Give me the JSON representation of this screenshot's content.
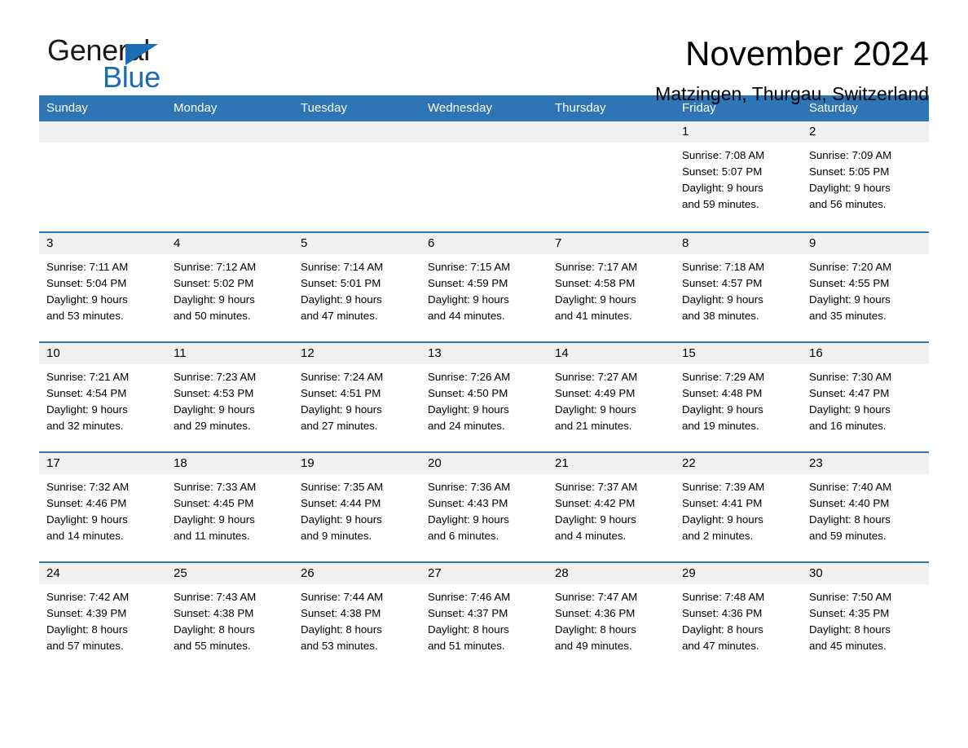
{
  "brand": {
    "name_part1": "General",
    "name_part2": "Blue",
    "triangle_icon": "blue-triangle-icon",
    "accent_color": "#1b6cb3"
  },
  "header": {
    "title": "November 2024",
    "subtitle": "Matzingen, Thurgau, Switzerland"
  },
  "theme": {
    "header_blue": "#2e75b6",
    "daynum_gray": "#f1f1f1",
    "text_black": "#000000"
  },
  "weekday_headers": [
    "Sunday",
    "Monday",
    "Tuesday",
    "Wednesday",
    "Thursday",
    "Friday",
    "Saturday"
  ],
  "weeks": [
    [
      {
        "day": "",
        "blank": true,
        "sunrise": "",
        "sunset": "",
        "daylight_line1": "",
        "daylight_line2": ""
      },
      {
        "day": "",
        "blank": true,
        "sunrise": "",
        "sunset": "",
        "daylight_line1": "",
        "daylight_line2": ""
      },
      {
        "day": "",
        "blank": true,
        "sunrise": "",
        "sunset": "",
        "daylight_line1": "",
        "daylight_line2": ""
      },
      {
        "day": "",
        "blank": true,
        "sunrise": "",
        "sunset": "",
        "daylight_line1": "",
        "daylight_line2": ""
      },
      {
        "day": "",
        "blank": true,
        "sunrise": "",
        "sunset": "",
        "daylight_line1": "",
        "daylight_line2": ""
      },
      {
        "day": "1",
        "blank": false,
        "sunrise": "Sunrise: 7:08 AM",
        "sunset": "Sunset: 5:07 PM",
        "daylight_line1": "Daylight: 9 hours",
        "daylight_line2": "and 59 minutes."
      },
      {
        "day": "2",
        "blank": false,
        "sunrise": "Sunrise: 7:09 AM",
        "sunset": "Sunset: 5:05 PM",
        "daylight_line1": "Daylight: 9 hours",
        "daylight_line2": "and 56 minutes."
      }
    ],
    [
      {
        "day": "3",
        "blank": false,
        "sunrise": "Sunrise: 7:11 AM",
        "sunset": "Sunset: 5:04 PM",
        "daylight_line1": "Daylight: 9 hours",
        "daylight_line2": "and 53 minutes."
      },
      {
        "day": "4",
        "blank": false,
        "sunrise": "Sunrise: 7:12 AM",
        "sunset": "Sunset: 5:02 PM",
        "daylight_line1": "Daylight: 9 hours",
        "daylight_line2": "and 50 minutes."
      },
      {
        "day": "5",
        "blank": false,
        "sunrise": "Sunrise: 7:14 AM",
        "sunset": "Sunset: 5:01 PM",
        "daylight_line1": "Daylight: 9 hours",
        "daylight_line2": "and 47 minutes."
      },
      {
        "day": "6",
        "blank": false,
        "sunrise": "Sunrise: 7:15 AM",
        "sunset": "Sunset: 4:59 PM",
        "daylight_line1": "Daylight: 9 hours",
        "daylight_line2": "and 44 minutes."
      },
      {
        "day": "7",
        "blank": false,
        "sunrise": "Sunrise: 7:17 AM",
        "sunset": "Sunset: 4:58 PM",
        "daylight_line1": "Daylight: 9 hours",
        "daylight_line2": "and 41 minutes."
      },
      {
        "day": "8",
        "blank": false,
        "sunrise": "Sunrise: 7:18 AM",
        "sunset": "Sunset: 4:57 PM",
        "daylight_line1": "Daylight: 9 hours",
        "daylight_line2": "and 38 minutes."
      },
      {
        "day": "9",
        "blank": false,
        "sunrise": "Sunrise: 7:20 AM",
        "sunset": "Sunset: 4:55 PM",
        "daylight_line1": "Daylight: 9 hours",
        "daylight_line2": "and 35 minutes."
      }
    ],
    [
      {
        "day": "10",
        "blank": false,
        "sunrise": "Sunrise: 7:21 AM",
        "sunset": "Sunset: 4:54 PM",
        "daylight_line1": "Daylight: 9 hours",
        "daylight_line2": "and 32 minutes."
      },
      {
        "day": "11",
        "blank": false,
        "sunrise": "Sunrise: 7:23 AM",
        "sunset": "Sunset: 4:53 PM",
        "daylight_line1": "Daylight: 9 hours",
        "daylight_line2": "and 29 minutes."
      },
      {
        "day": "12",
        "blank": false,
        "sunrise": "Sunrise: 7:24 AM",
        "sunset": "Sunset: 4:51 PM",
        "daylight_line1": "Daylight: 9 hours",
        "daylight_line2": "and 27 minutes."
      },
      {
        "day": "13",
        "blank": false,
        "sunrise": "Sunrise: 7:26 AM",
        "sunset": "Sunset: 4:50 PM",
        "daylight_line1": "Daylight: 9 hours",
        "daylight_line2": "and 24 minutes."
      },
      {
        "day": "14",
        "blank": false,
        "sunrise": "Sunrise: 7:27 AM",
        "sunset": "Sunset: 4:49 PM",
        "daylight_line1": "Daylight: 9 hours",
        "daylight_line2": "and 21 minutes."
      },
      {
        "day": "15",
        "blank": false,
        "sunrise": "Sunrise: 7:29 AM",
        "sunset": "Sunset: 4:48 PM",
        "daylight_line1": "Daylight: 9 hours",
        "daylight_line2": "and 19 minutes."
      },
      {
        "day": "16",
        "blank": false,
        "sunrise": "Sunrise: 7:30 AM",
        "sunset": "Sunset: 4:47 PM",
        "daylight_line1": "Daylight: 9 hours",
        "daylight_line2": "and 16 minutes."
      }
    ],
    [
      {
        "day": "17",
        "blank": false,
        "sunrise": "Sunrise: 7:32 AM",
        "sunset": "Sunset: 4:46 PM",
        "daylight_line1": "Daylight: 9 hours",
        "daylight_line2": "and 14 minutes."
      },
      {
        "day": "18",
        "blank": false,
        "sunrise": "Sunrise: 7:33 AM",
        "sunset": "Sunset: 4:45 PM",
        "daylight_line1": "Daylight: 9 hours",
        "daylight_line2": "and 11 minutes."
      },
      {
        "day": "19",
        "blank": false,
        "sunrise": "Sunrise: 7:35 AM",
        "sunset": "Sunset: 4:44 PM",
        "daylight_line1": "Daylight: 9 hours",
        "daylight_line2": "and 9 minutes."
      },
      {
        "day": "20",
        "blank": false,
        "sunrise": "Sunrise: 7:36 AM",
        "sunset": "Sunset: 4:43 PM",
        "daylight_line1": "Daylight: 9 hours",
        "daylight_line2": "and 6 minutes."
      },
      {
        "day": "21",
        "blank": false,
        "sunrise": "Sunrise: 7:37 AM",
        "sunset": "Sunset: 4:42 PM",
        "daylight_line1": "Daylight: 9 hours",
        "daylight_line2": "and 4 minutes."
      },
      {
        "day": "22",
        "blank": false,
        "sunrise": "Sunrise: 7:39 AM",
        "sunset": "Sunset: 4:41 PM",
        "daylight_line1": "Daylight: 9 hours",
        "daylight_line2": "and 2 minutes."
      },
      {
        "day": "23",
        "blank": false,
        "sunrise": "Sunrise: 7:40 AM",
        "sunset": "Sunset: 4:40 PM",
        "daylight_line1": "Daylight: 8 hours",
        "daylight_line2": "and 59 minutes."
      }
    ],
    [
      {
        "day": "24",
        "blank": false,
        "sunrise": "Sunrise: 7:42 AM",
        "sunset": "Sunset: 4:39 PM",
        "daylight_line1": "Daylight: 8 hours",
        "daylight_line2": "and 57 minutes."
      },
      {
        "day": "25",
        "blank": false,
        "sunrise": "Sunrise: 7:43 AM",
        "sunset": "Sunset: 4:38 PM",
        "daylight_line1": "Daylight: 8 hours",
        "daylight_line2": "and 55 minutes."
      },
      {
        "day": "26",
        "blank": false,
        "sunrise": "Sunrise: 7:44 AM",
        "sunset": "Sunset: 4:38 PM",
        "daylight_line1": "Daylight: 8 hours",
        "daylight_line2": "and 53 minutes."
      },
      {
        "day": "27",
        "blank": false,
        "sunrise": "Sunrise: 7:46 AM",
        "sunset": "Sunset: 4:37 PM",
        "daylight_line1": "Daylight: 8 hours",
        "daylight_line2": "and 51 minutes."
      },
      {
        "day": "28",
        "blank": false,
        "sunrise": "Sunrise: 7:47 AM",
        "sunset": "Sunset: 4:36 PM",
        "daylight_line1": "Daylight: 8 hours",
        "daylight_line2": "and 49 minutes."
      },
      {
        "day": "29",
        "blank": false,
        "sunrise": "Sunrise: 7:48 AM",
        "sunset": "Sunset: 4:36 PM",
        "daylight_line1": "Daylight: 8 hours",
        "daylight_line2": "and 47 minutes."
      },
      {
        "day": "30",
        "blank": false,
        "sunrise": "Sunrise: 7:50 AM",
        "sunset": "Sunset: 4:35 PM",
        "daylight_line1": "Daylight: 8 hours",
        "daylight_line2": "and 45 minutes."
      }
    ]
  ]
}
